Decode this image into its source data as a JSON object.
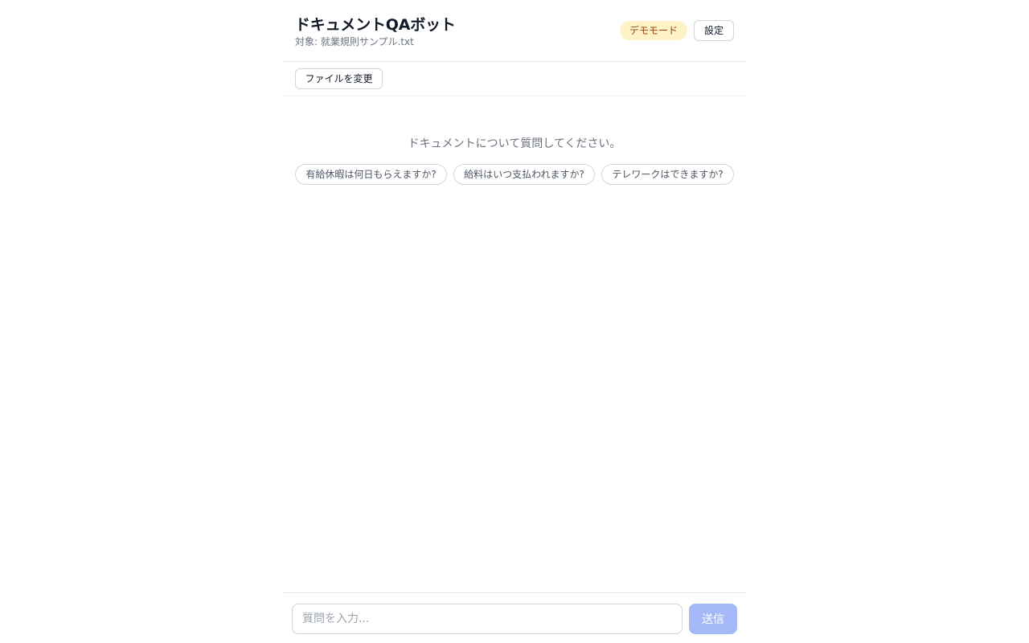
{
  "header": {
    "title": "ドキュメントQAボット",
    "subtitle": "対象: 就業規則サンプル.txt",
    "demo_badge": "デモモード",
    "settings_label": "設定"
  },
  "toolbar": {
    "change_file_label": "ファイルを変更"
  },
  "main": {
    "empty_prompt": "ドキュメントについて質問してください。",
    "suggestions": [
      "有給休暇は何日もらえますか?",
      "給料はいつ支払われますか?",
      "テレワークはできますか?"
    ]
  },
  "composer": {
    "input_value": "",
    "input_placeholder": "質問を入力...",
    "send_label": "送信"
  },
  "colors": {
    "demo_badge_bg": "#fef3c7",
    "demo_badge_text": "#92400e",
    "send_button_disabled": "#a5b9f8"
  }
}
